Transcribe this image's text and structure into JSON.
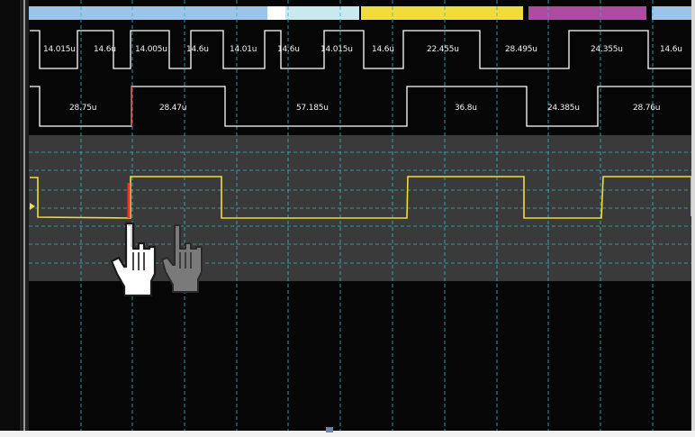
{
  "decode_bar": {
    "segments": [
      {
        "name": "blue-1",
        "color": "#9cc3e8"
      },
      {
        "name": "white",
        "color": "#ffffff"
      },
      {
        "name": "cyan",
        "color": "#c8eaee"
      },
      {
        "name": "yellow",
        "color": "#f0dc3a"
      },
      {
        "name": "magenta",
        "color": "#b04aa0"
      },
      {
        "name": "blue-2",
        "color": "#9cc3e8"
      }
    ]
  },
  "timing_row_1": {
    "labels": [
      "14.015u",
      "14.6u",
      "14.005u",
      "14.6u",
      "14.01u",
      "14.6u",
      "14.015u",
      "14.6u",
      "22.455u",
      "28.495u",
      "24.355u",
      "14.6u"
    ]
  },
  "timing_row_2": {
    "labels": [
      "28.75u",
      "28.47u",
      "57.185u",
      "36.8u",
      "24.385u",
      "28.76u"
    ]
  },
  "waveform": {
    "trace_color": "#f0dc3a",
    "cursor_color": "#ff2a2a",
    "grid_color": "#2fb7c7",
    "lane_background": "#3a3a3a"
  },
  "cursors": {
    "primary": "hand-cursor",
    "ghost": "hand-cursor-ghost"
  }
}
